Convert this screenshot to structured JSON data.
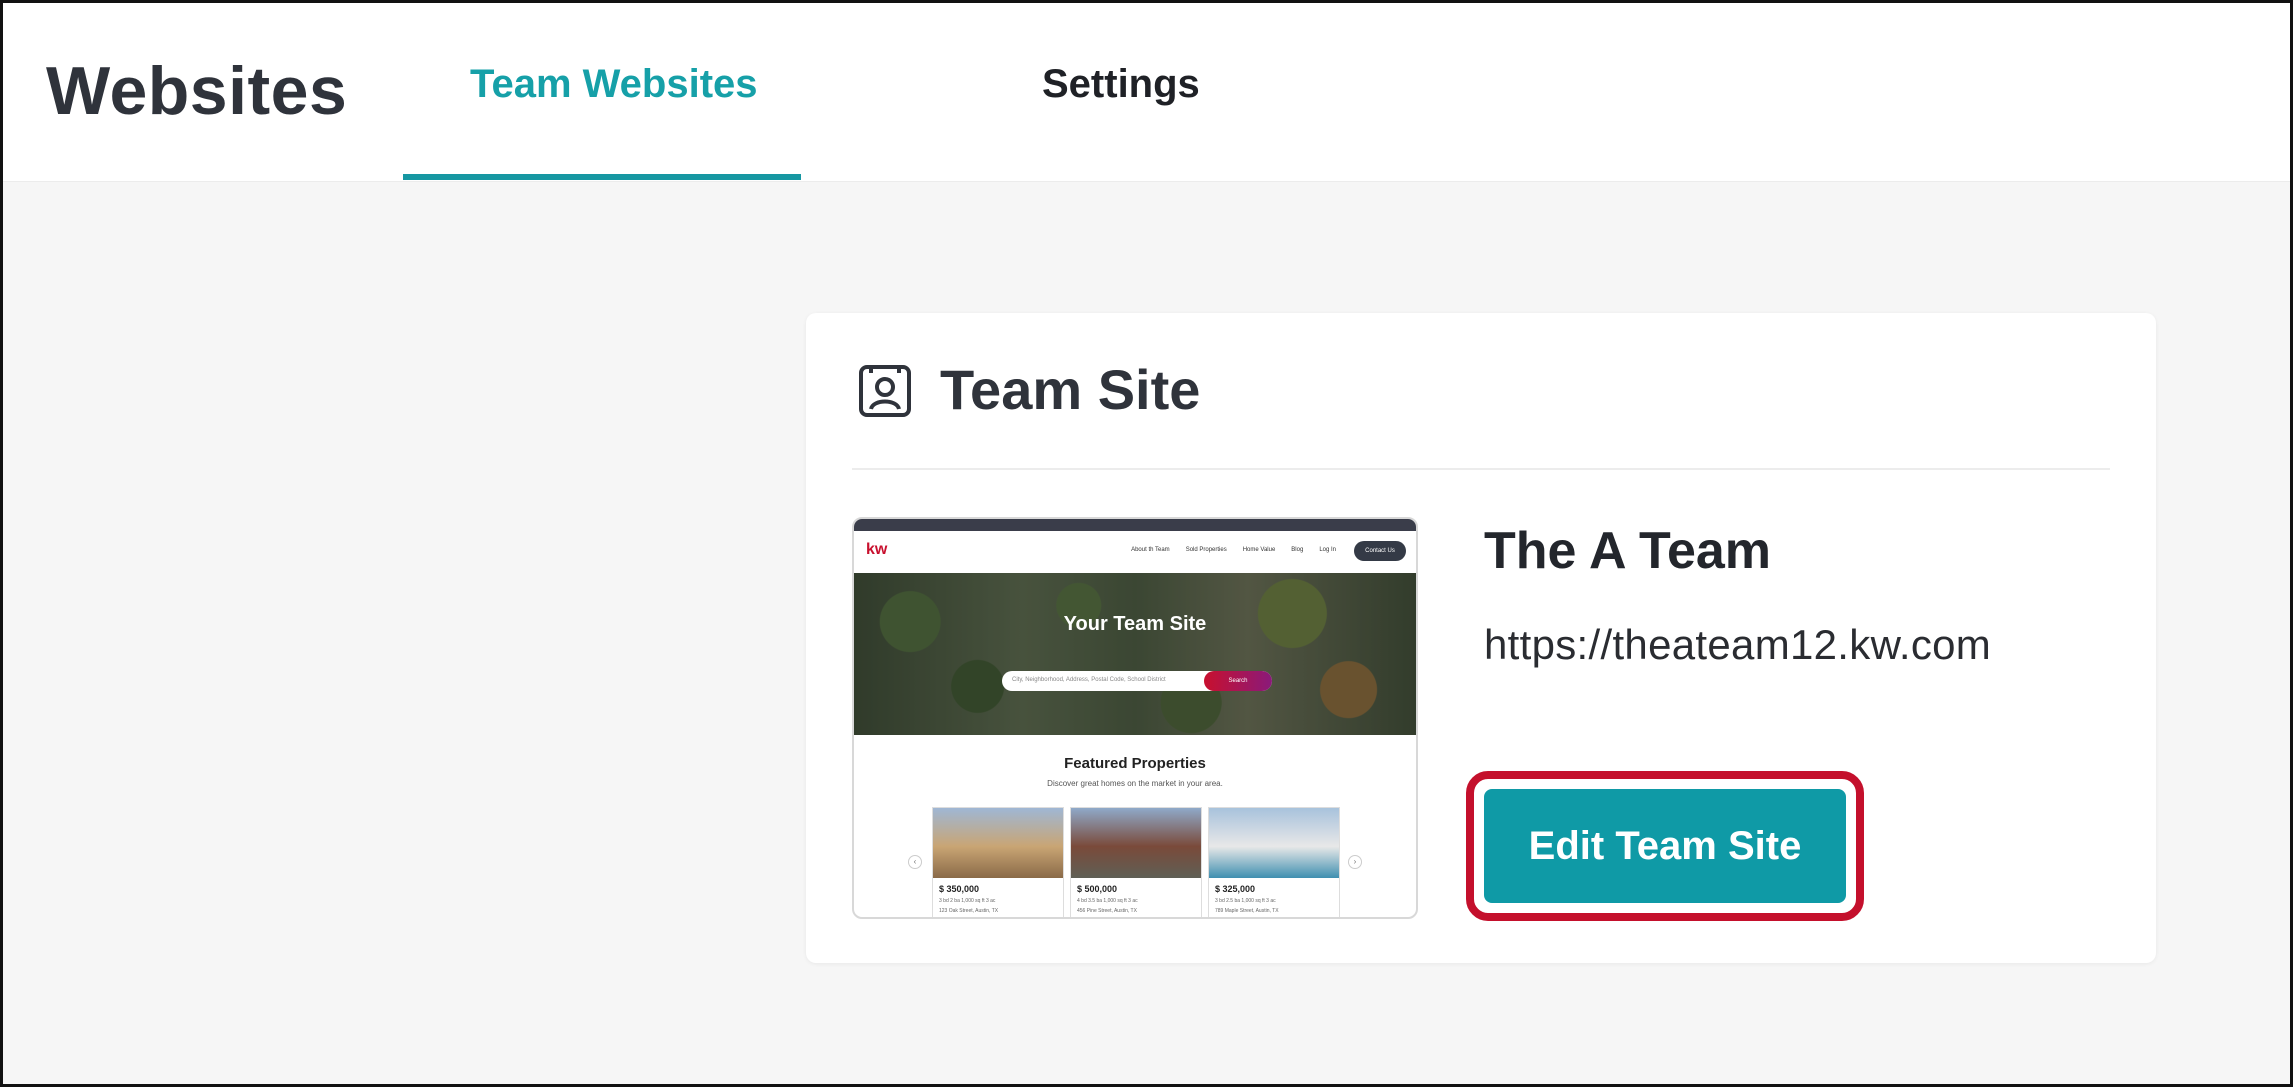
{
  "header": {
    "app_title": "Websites",
    "tabs": [
      {
        "label": "Team Websites",
        "active": true
      },
      {
        "label": "Settings",
        "active": false
      }
    ],
    "accent_color": "#16a0a8"
  },
  "card": {
    "icon": "user-profile-icon",
    "title": "Team Site",
    "team_name": "The A Team",
    "url": "https://theateam12.kw.com",
    "edit_button_label": "Edit Team Site",
    "button_color": "#0f9aa6",
    "highlight_color": "#c4102c"
  },
  "preview": {
    "logo": "kw",
    "nav_links": [
      "About th Team",
      "Sold Properties",
      "Home Value",
      "Blog",
      "Log In"
    ],
    "contact_label": "Contact Us",
    "hero_title": "Your Team Site",
    "search_placeholder": "City, Neighborhood, Address, Postal Code, School District",
    "search_button": "Search",
    "featured_title": "Featured Properties",
    "featured_subtitle": "Discover great homes on the market in your area.",
    "listings": [
      {
        "price": "$ 350,000",
        "info": "3 bd  2 ba  1,000 sq ft  3 ac",
        "address": "123 Oak Street, Austin, TX"
      },
      {
        "price": "$ 500,000",
        "info": "4 bd  3.5 ba  1,000 sq ft  3 ac",
        "address": "456 Pine Street, Austin, TX"
      },
      {
        "price": "$ 325,000",
        "info": "3 bd  2.5 ba  1,000 sq ft  3 ac",
        "address": "789 Maple Street, Austin, TX"
      }
    ]
  }
}
